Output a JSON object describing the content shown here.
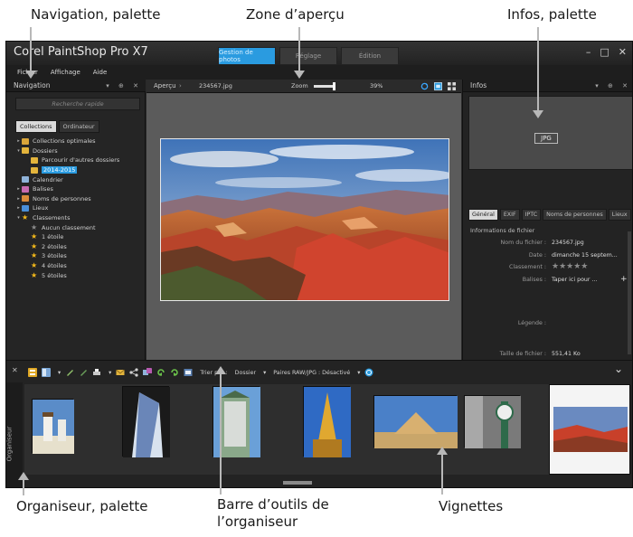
{
  "callouts": {
    "navigation_palette": "Navigation, palette",
    "preview_area": "Zone d’aperçu",
    "info_palette": "Infos, palette",
    "organizer_palette": "Organiseur, palette",
    "organizer_toolbar_line1": "Barre d’outils de",
    "organizer_toolbar_line2": "l’organiseur",
    "thumbnails": "Vignettes"
  },
  "app": {
    "title": "Corel PaintShop Pro X7",
    "mode_tabs": [
      {
        "label": "Gestion de photos",
        "active": true
      },
      {
        "label": "Réglage",
        "active": false
      },
      {
        "label": "Édition",
        "active": false
      }
    ],
    "window_controls": {
      "minimize": "–",
      "maximize": "□",
      "close": "✕"
    },
    "menu": [
      "Fichier",
      "Affichage",
      "Aide"
    ]
  },
  "navigation": {
    "title": "Navigation",
    "controls": "▾ ⊕ ✕",
    "search_placeholder": "Recherche rapide",
    "tabs": [
      {
        "label": "Collections",
        "active": true
      },
      {
        "label": "Ordinateur",
        "active": false
      }
    ],
    "tree": [
      {
        "label": "Collections optimales",
        "indent": 0,
        "twisty": "▸",
        "icon": "smart-collection-icon",
        "color": "#d9a53a"
      },
      {
        "label": "Dossiers",
        "indent": 0,
        "twisty": "▾",
        "icon": "folder-icon",
        "color": "#e3b43c"
      },
      {
        "label": "Parcourir d'autres dossiers",
        "indent": 1,
        "twisty": "",
        "icon": "browse-folder-icon",
        "color": "#e3b43c"
      },
      {
        "label": "2014-2015",
        "indent": 1,
        "twisty": "",
        "icon": "folder-icon",
        "color": "#e3b43c",
        "selected": true
      },
      {
        "label": "Calendrier",
        "indent": 0,
        "twisty": "",
        "icon": "calendar-icon",
        "color": "#8fb3d9"
      },
      {
        "label": "Balises",
        "indent": 0,
        "twisty": "▸",
        "icon": "tag-icon",
        "color": "#c76bb0"
      },
      {
        "label": "Noms de personnes",
        "indent": 0,
        "twisty": "▸",
        "icon": "people-icon",
        "color": "#d98b3a"
      },
      {
        "label": "Lieux",
        "indent": 0,
        "twisty": "▸",
        "icon": "places-icon",
        "color": "#4a8fd9"
      },
      {
        "label": "Classements",
        "indent": 0,
        "twisty": "▾",
        "icon": "star-icon",
        "star": true
      },
      {
        "label": "Aucun classement",
        "indent": 1,
        "twisty": "",
        "icon": "star-outline-icon",
        "star": true,
        "grey": true
      },
      {
        "label": "1 étoile",
        "indent": 1,
        "twisty": "",
        "icon": "star-icon",
        "star": true
      },
      {
        "label": "2 étoiles",
        "indent": 1,
        "twisty": "",
        "icon": "star-icon",
        "star": true
      },
      {
        "label": "3 étoiles",
        "indent": 1,
        "twisty": "",
        "icon": "star-icon",
        "star": true
      },
      {
        "label": "4 étoiles",
        "indent": 1,
        "twisty": "",
        "icon": "star-icon",
        "star": true
      },
      {
        "label": "5 étoiles",
        "indent": 1,
        "twisty": "",
        "icon": "star-icon",
        "star": true
      }
    ]
  },
  "preview": {
    "title": "Aperçu",
    "separator": "›",
    "filename": "234567.jpg",
    "zoom_label": "Zoom",
    "zoom_percent": "39%",
    "zoom_fraction": 0.39
  },
  "info": {
    "title": "Infos",
    "controls": "▾ ⊕ ✕",
    "format_badge": "JPG",
    "tabs": [
      {
        "label": "Général",
        "active": true
      },
      {
        "label": "EXIF",
        "active": false
      },
      {
        "label": "IPTC",
        "active": false
      },
      {
        "label": "Noms de personnes",
        "active": false
      },
      {
        "label": "Lieux",
        "active": false
      }
    ],
    "section_title": "Informations de fichier",
    "fields": [
      {
        "key": "Nom du fichier :",
        "value": "234567.jpg"
      },
      {
        "key": "Date :",
        "value": "dimanche 15 septem..."
      },
      {
        "key": "Classement :",
        "value": "★★★★★"
      },
      {
        "key": "Balises :",
        "value": "Taper ici pour ..."
      },
      {
        "key": "Légende :",
        "value": ""
      },
      {
        "key": "Taille de fichier :",
        "value": "551,41 Ko"
      }
    ],
    "add_tag_symbol": "+"
  },
  "organizer": {
    "side_label": "Organiseur",
    "sort_label": "Trier par :",
    "sort_value": "Dossier",
    "raw_label": "Paires RAW/JPG : Désactivé",
    "collapse_symbol": "⌄",
    "close_symbol": "✕",
    "thumbnails": [
      {
        "name": "windmills",
        "selected": false
      },
      {
        "name": "glass-tower",
        "selected": false
      },
      {
        "name": "modern-building",
        "selected": false
      },
      {
        "name": "golden-pagoda",
        "selected": false
      },
      {
        "name": "step-pyramid",
        "selected": false
      },
      {
        "name": "street-clock",
        "selected": false
      },
      {
        "name": "grand-canyon",
        "selected": true
      }
    ]
  },
  "colors": {
    "accent_blue": "#2a9be0",
    "panel_bg": "#252525",
    "preview_bg": "#5b5b5b",
    "star_gold": "#f2b81a"
  }
}
